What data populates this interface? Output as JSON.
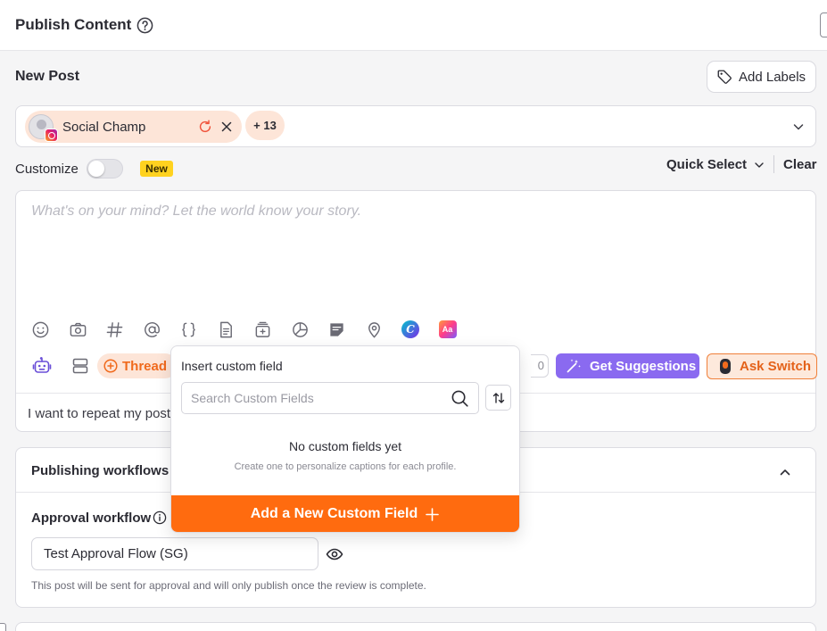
{
  "header": {
    "title": "Publish Content"
  },
  "post": {
    "section_title": "New Post",
    "add_labels": "Add Labels"
  },
  "profiles": {
    "selected_name": "Social Champ",
    "more_count": "+ 13"
  },
  "customize": {
    "label": "Customize",
    "toggle_on": false,
    "new_badge": "New",
    "quick_select": "Quick Select",
    "clear": "Clear"
  },
  "editor": {
    "placeholder": "What's on your mind? Let the world know your story.",
    "toolbar_icons": [
      "emoji-icon",
      "camera-icon",
      "hashtag-icon",
      "mention-icon",
      "custom-field-braces-icon",
      "document-icon",
      "media-library-icon",
      "chart-icon",
      "note-icon",
      "location-icon",
      "canva-icon",
      "ai-text-icon"
    ],
    "canva_glyph": "C",
    "ae_glyph": "Aa",
    "thread_label": "Thread",
    "count_stub": "0",
    "get_suggestions": "Get Suggestions",
    "ask_switch": "Ask Switch",
    "repeat_text": "I want to repeat my post"
  },
  "workflows": {
    "title": "Publishing workflows",
    "approval_label": "Approval workflow",
    "approval_value": "Test Approval Flow (SG)",
    "approval_note": "This post will be sent for approval and will only publish once the review is complete."
  },
  "custom_field_popover": {
    "title": "Insert custom field",
    "search_placeholder": "Search Custom Fields",
    "search_value": "",
    "empty_title": "No custom fields yet",
    "empty_subtitle": "Create one to personalize captions for each profile.",
    "add_button": "Add a New Custom Field"
  },
  "colors": {
    "accent_orange": "#ff6b0f",
    "chip_bg": "#fde5d8",
    "suggest_purple": "#8a6af0",
    "new_badge_yellow": "#ffd21f"
  }
}
